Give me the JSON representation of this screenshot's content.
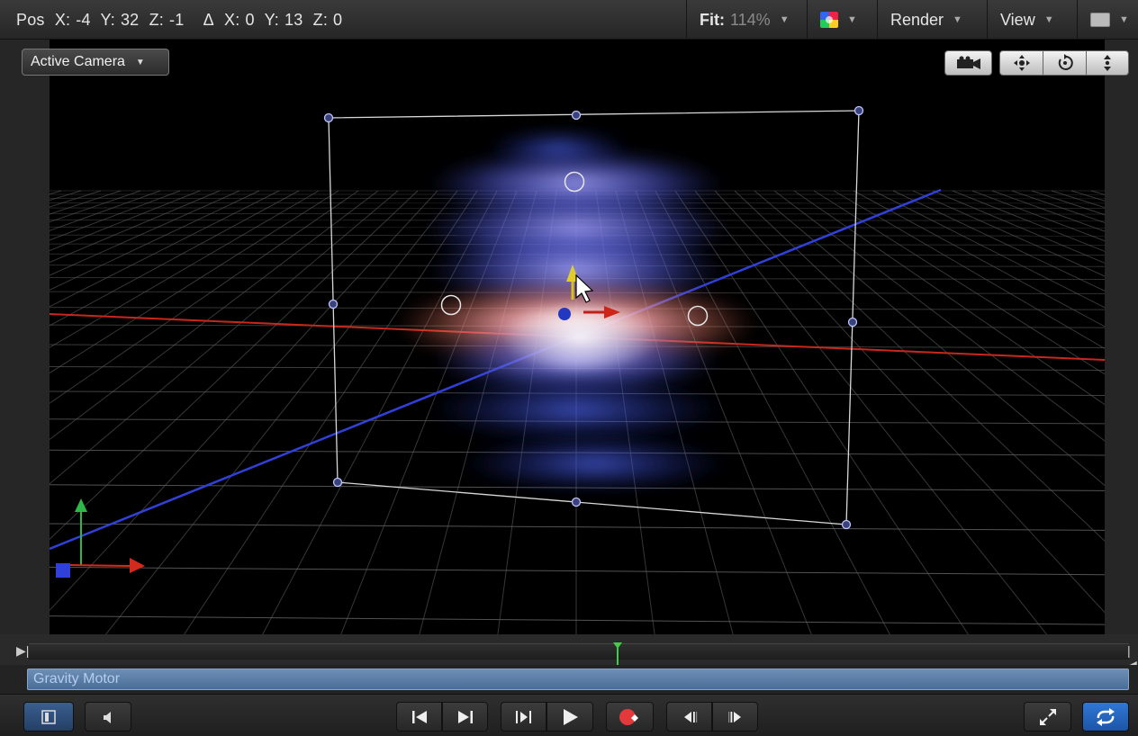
{
  "status_bar": {
    "pos_label": "Pos",
    "x_label": "X:",
    "x_value": "-4",
    "y_label": "Y:",
    "y_value": "32",
    "z_label": "Z:",
    "z_value": "-1",
    "delta_label": "Δ",
    "dx_label": "X:",
    "dx_value": "0",
    "dy_label": "Y:",
    "dy_value": "13",
    "dz_label": "Z:",
    "dz_value": "0"
  },
  "toolbar": {
    "fit_label": "Fit:",
    "fit_value": "114%",
    "render_label": "Render",
    "view_label": "View",
    "dropdown_arrow": "▼"
  },
  "viewport": {
    "camera_menu_label": "Active Camera",
    "camera_menu_arrow": "▼"
  },
  "timeline": {
    "in_marker": "▶|",
    "out_marker": "|◀",
    "track_label": "Gravity Motor"
  },
  "icons": {
    "color_channels": "color-channels-icon",
    "layout": "layout-icon",
    "camera": "camera-icon",
    "pan": "pan-icon",
    "orbit": "orbit-icon",
    "dolly": "dolly-icon",
    "playhead": "playhead-icon",
    "panel_toggle": "panel-toggle-icon",
    "mute": "speaker-icon",
    "go_to_start": "go-to-start-icon",
    "go_to_end": "go-to-end-icon",
    "play_from_start": "play-from-start-icon",
    "play": "play-icon",
    "record": "record-icon",
    "previous_frame": "previous-frame-icon",
    "next_frame": "next-frame-icon",
    "fullscreen": "fullscreen-icon",
    "loop": "loop-icon"
  },
  "colors": {
    "x_axis": "#d32a1e",
    "y_axis": "#2fb84a",
    "z_axis": "#3040d8",
    "loop_active": "#2f78d6",
    "track_bar": "#5a7ca8"
  }
}
